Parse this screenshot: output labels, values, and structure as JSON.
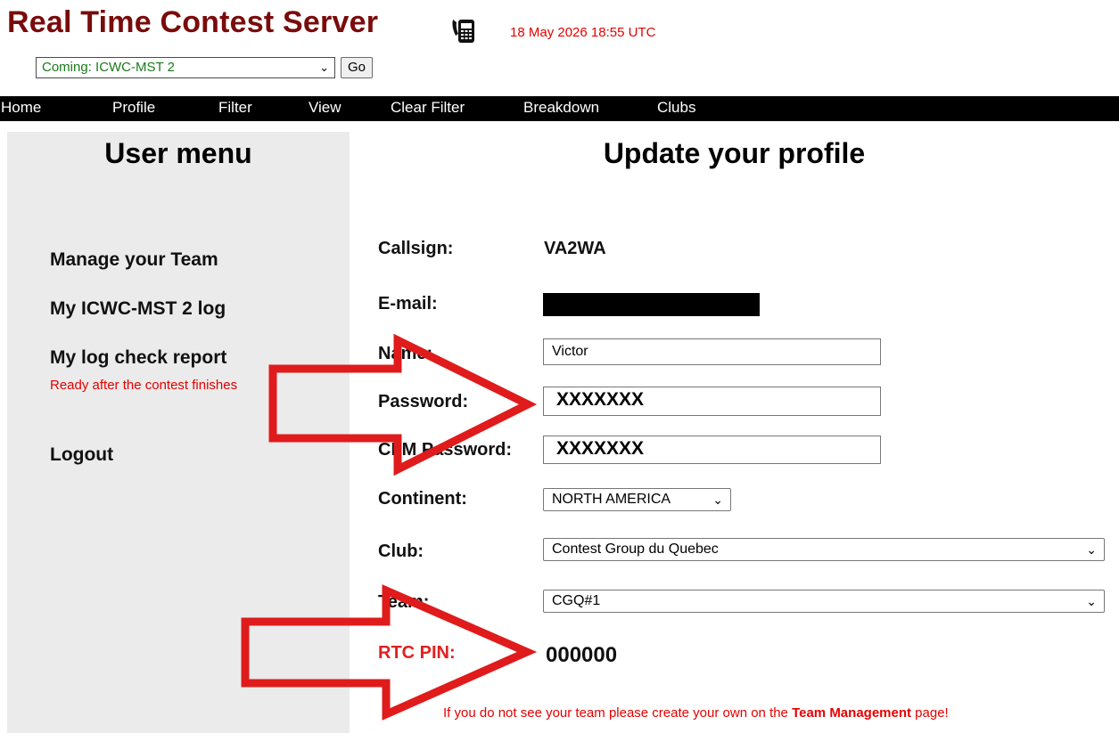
{
  "header": {
    "title": "Real Time Contest Server",
    "datetime": "18 May 2026 18:55 UTC",
    "icon": "phone-icon"
  },
  "contest_selector": {
    "selected": "Coming: ICWC-MST 2",
    "go_label": "Go"
  },
  "nav": {
    "items": [
      {
        "label": "Home"
      },
      {
        "label": "Profile"
      },
      {
        "label": "Filter"
      },
      {
        "label": "View"
      },
      {
        "label": "Clear Filter"
      },
      {
        "label": "Breakdown"
      },
      {
        "label": "Clubs"
      }
    ]
  },
  "sidebar": {
    "title": "User menu",
    "items": [
      {
        "label": "Manage your Team"
      },
      {
        "label": "My ICWC-MST 2 log"
      },
      {
        "label": "My log check report"
      },
      {
        "label": "Logout"
      }
    ],
    "note": "Ready after the contest finishes"
  },
  "profile": {
    "title": "Update your profile",
    "callsign_label": "Callsign:",
    "callsign_value": "VA2WA",
    "email_label": "E-mail:",
    "name_label": "Name:",
    "name_value": "Victor",
    "password_label": "Password:",
    "password_value": "XXXXXXX",
    "cfm_password_label": "CFM Password:",
    "cfm_password_value": "XXXXXXX",
    "continent_label": "Continent:",
    "continent_value": "NORTH AMERICA",
    "club_label": "Club:",
    "club_value": "Contest Group du Quebec",
    "team_label": "Team:",
    "team_value": "CGQ#1",
    "pin_label": "RTC PIN:",
    "pin_value": "000000",
    "note_prefix": "If you do not see your team please create your own on the ",
    "note_link": "Team Management",
    "note_suffix": " page!"
  },
  "colors": {
    "title": "#7a0b0b",
    "accent_red": "#e60000",
    "nav_bg": "#000000",
    "sidebar_bg": "#ebebeb",
    "select_text": "#1b7a1b",
    "arrow": "#e01b1b"
  }
}
